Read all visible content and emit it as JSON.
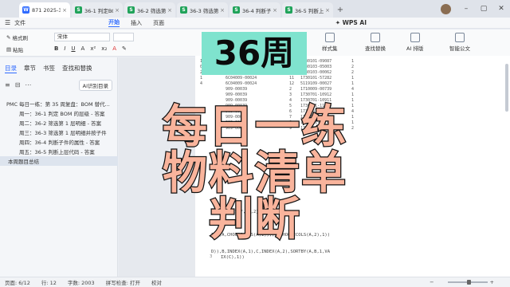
{
  "tabs": [
    {
      "label": "871 2025-36",
      "icon": "W",
      "color": "#2f6bff",
      "active": true
    },
    {
      "label": "36-1 判定BOM",
      "icon": "S",
      "color": "#20a35a"
    },
    {
      "label": "36-2 筛选第1层",
      "icon": "S",
      "color": "#20a35a"
    },
    {
      "label": "36-3 筛选第1层",
      "icon": "S",
      "color": "#20a35a"
    },
    {
      "label": "36-4 判断子件",
      "icon": "S",
      "color": "#20a35a"
    },
    {
      "label": "36-5 判断上层",
      "icon": "S",
      "color": "#20a35a"
    }
  ],
  "menu": {
    "file": "文件",
    "items": [
      "开始",
      "插入",
      "页面"
    ],
    "wps_ai": "WPS AI"
  },
  "ribbon": {
    "format_painter": "格式刷",
    "paste": "粘贴",
    "font_name": "宋体",
    "style_set": "样式集",
    "find_replace": "查找替换",
    "ai_layout": "AI 排版",
    "smart_doc": "智能公文"
  },
  "sidebar": {
    "tabs": [
      "目录",
      "章节",
      "书签",
      "查找和替换"
    ],
    "ai_button": "AI识别目录",
    "toc": [
      {
        "text": "PMC 每日一练：第 35 周复盘：BOM 替代...",
        "level": 1
      },
      {
        "text": "周一：36-1 判定 BOM 的层级 - 答案",
        "level": 2
      },
      {
        "text": "周二：36-2 筛选第 1 层明细 - 答案",
        "level": 2
      },
      {
        "text": "周三：36-3 筛选第 1 层明细并按子件",
        "level": 2
      },
      {
        "text": "周四：36-4 判断子件的属性 - 答案",
        "level": 2
      },
      {
        "text": "周五：36-5 判断上层代码 - 答案",
        "level": 2
      },
      {
        "text": "本周题目总结",
        "level": 1,
        "selected": true
      }
    ]
  },
  "overlay": {
    "week": "36周",
    "line1": "每日一练",
    "line2": "物料清单",
    "line3": "判断"
  },
  "doc_rows": [
    [
      "1.224",
      "6C04009-00024",
      "8",
      "1730101-09087",
      "1"
    ],
    [
      "0.3",
      "6C04009-00024",
      "9",
      "1730103-05003",
      "2"
    ],
    [
      "2",
      "6C04009-00024",
      "10",
      "1730103-00062",
      "2"
    ],
    [
      "1",
      "6C04009-00024",
      "11",
      "1730101-57282",
      "1"
    ],
    [
      "4",
      "6C04009-00024",
      "12",
      "5119109-00027",
      "1"
    ],
    [
      "",
      "909-00039",
      "2",
      "1710009-00739",
      "4"
    ],
    [
      "",
      "909-00039",
      "3",
      "1730701-10912",
      "1"
    ],
    [
      "",
      "909-00039",
      "4",
      "1730701-10911",
      "1"
    ],
    [
      "",
      "909-00039",
      "5",
      "1730701-11296",
      "1"
    ],
    [
      "",
      "909-00039",
      "6",
      "1730701-00739",
      "4"
    ],
    [
      "",
      "909-00039",
      "7",
      "17585-29957",
      "1"
    ],
    [
      "",
      "909-00039",
      "8",
      "1730101-09740",
      "1"
    ],
    [
      "",
      "909-00039",
      "9",
      "1730103-05904",
      "2"
    ]
  ],
  "formulas": [
    "000)),SORT(F,{1,2},{1,-1},0))",
    "TBY(A,CHOOSECOLS(A,1)),,--CHOOSECOLS(A,2),1))",
    "D)),B,INDEX(A,1),C,INDEX(A,2),SORTBY(A,B,1,VA",
    "IX(C),1))"
  ],
  "line_number": "3",
  "status": {
    "page": "页面: 6/12",
    "line": "行: 12",
    "words": "字数: 2003",
    "spell": "拼写检查: 打开",
    "proof": "校对"
  }
}
